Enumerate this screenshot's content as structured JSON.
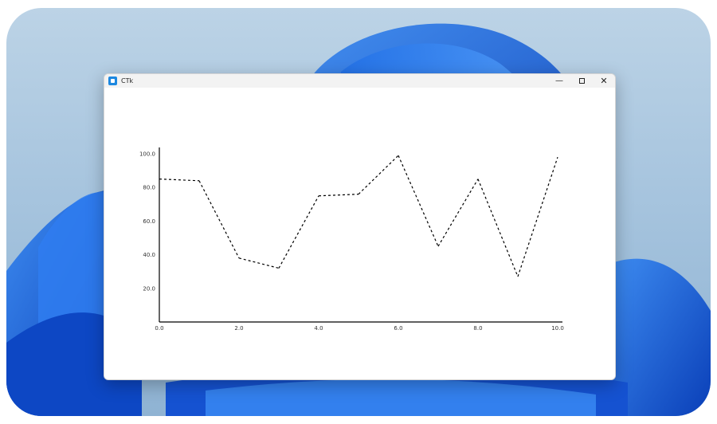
{
  "window": {
    "title": "CTk",
    "minimize_label": "—",
    "close_label": "✕",
    "icons": [
      "app-icon",
      "minimize-icon",
      "maximize-icon",
      "close-icon"
    ]
  },
  "chart_data": {
    "type": "line",
    "line_style": "dashed",
    "line_color": "#000000",
    "x": [
      0,
      1,
      2,
      3,
      4,
      5,
      6,
      7,
      8,
      9,
      10
    ],
    "y": [
      85,
      84,
      38,
      32,
      75,
      76,
      99,
      45,
      85,
      27,
      98
    ],
    "x_ticks": [
      "0.0",
      "2.0",
      "4.0",
      "6.0",
      "8.0",
      "10.0"
    ],
    "y_ticks": [
      "20.0",
      "40.0",
      "60.0",
      "80.0",
      "100.0"
    ],
    "xlim": [
      0,
      10
    ],
    "ylim": [
      0,
      100
    ],
    "grid": false,
    "title": "",
    "xlabel": "",
    "ylabel": ""
  }
}
